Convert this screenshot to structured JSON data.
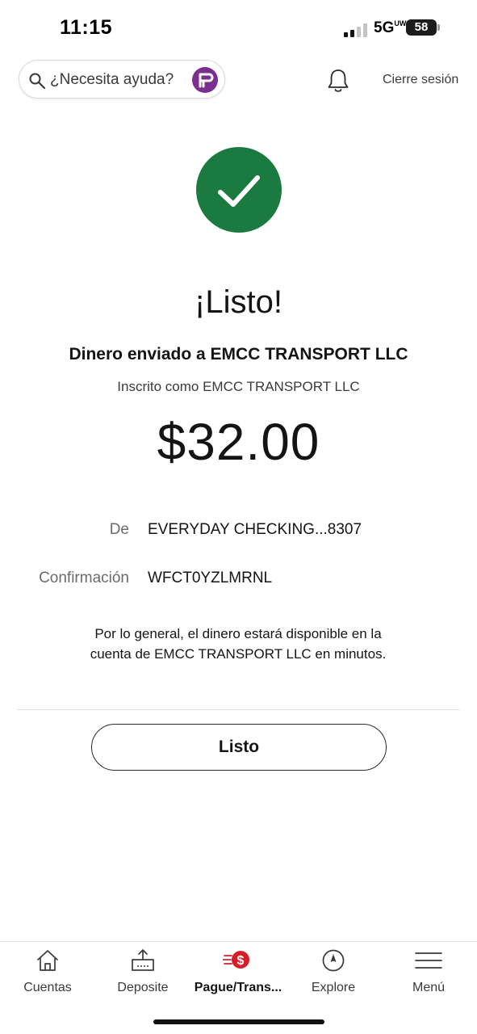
{
  "status_bar": {
    "time": "11:15",
    "network": "5G",
    "network_suffix": "UW",
    "battery": "58"
  },
  "header": {
    "search_placeholder": "¿Necesita ayuda?",
    "search_icon": "search-icon",
    "assistant_icon": "fargo-assistant-icon",
    "notifications_icon": "bell-icon",
    "signout_label": "Cierre sesión"
  },
  "confirmation": {
    "status_icon": "checkmark-icon",
    "title": "¡Listo!",
    "subtitle": "Dinero enviado a EMCC TRANSPORT LLC",
    "enrolled_as": "Inscrito como EMCC TRANSPORT LLC",
    "amount": "$32.00",
    "details": [
      {
        "label": "De",
        "value": "EVERYDAY CHECKING...8307"
      },
      {
        "label": "Confirmación",
        "value": "WFCT0YZLMRNL"
      }
    ],
    "note_line1": "Por lo general, el dinero estará disponible en la",
    "note_line2": "cuenta de EMCC TRANSPORT LLC en minutos.",
    "done_button": "Listo"
  },
  "bottom_nav": {
    "items": [
      {
        "label": "Cuentas",
        "icon": "home-icon"
      },
      {
        "label": "Deposite",
        "icon": "deposit-icon"
      },
      {
        "label": "Pague/Trans...",
        "icon": "pay-transfer-icon",
        "active": true
      },
      {
        "label": "Explore",
        "icon": "compass-icon"
      },
      {
        "label": "Menú",
        "icon": "menu-icon"
      }
    ]
  },
  "colors": {
    "success_green": "#1a7a3f",
    "brand_red": "#d71e28",
    "assistant_purple": "#7a2e8f"
  }
}
